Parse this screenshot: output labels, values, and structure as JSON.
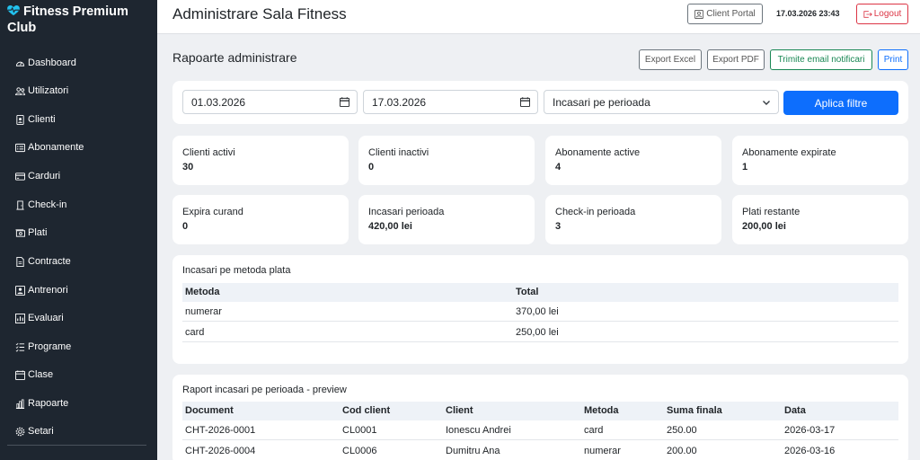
{
  "app": {
    "brand": "Fitness Premium Club",
    "brand_color": "#1e2630",
    "accent": "#0d6efd"
  },
  "sidebar": {
    "items": [
      {
        "label": "Dashboard",
        "icon": "speedometer-icon"
      },
      {
        "label": "Utilizatori",
        "icon": "people-icon"
      },
      {
        "label": "Clienti",
        "icon": "person-badge-icon"
      },
      {
        "label": "Abonamente",
        "icon": "card-list-icon"
      },
      {
        "label": "Carduri",
        "icon": "credit-card-icon"
      },
      {
        "label": "Check-in",
        "icon": "door-icon"
      },
      {
        "label": "Plati",
        "icon": "cash-icon"
      },
      {
        "label": "Contracte",
        "icon": "file-text-icon"
      },
      {
        "label": "Antrenori",
        "icon": "person-square-icon"
      },
      {
        "label": "Evaluari",
        "icon": "graph-icon"
      },
      {
        "label": "Programe",
        "icon": "list-check-icon"
      },
      {
        "label": "Clase",
        "icon": "calendar-icon"
      },
      {
        "label": "Rapoarte",
        "icon": "bar-chart-icon"
      },
      {
        "label": "Setari",
        "icon": "gear-icon"
      }
    ]
  },
  "header": {
    "title": "Administrare Sala Fitness",
    "client_portal": "Client Portal",
    "datetime": "17.03.2026 23:43",
    "logout": "Logout"
  },
  "reports": {
    "title": "Rapoarte administrare",
    "export_excel": "Export Excel",
    "export_pdf": "Export PDF",
    "send_email": "Trimite email notificari",
    "print": "Print"
  },
  "filters": {
    "date_from": "01.03.2026",
    "date_to": "17.03.2026",
    "report_type": "Incasari pe perioada",
    "apply": "Aplica filtre"
  },
  "stats": [
    {
      "label": "Clienti activi",
      "value": "30"
    },
    {
      "label": "Clienti inactivi",
      "value": "0"
    },
    {
      "label": "Abonamente active",
      "value": "4"
    },
    {
      "label": "Abonamente expirate",
      "value": "1"
    },
    {
      "label": "Expira curand",
      "value": "0"
    },
    {
      "label": "Incasari perioada",
      "value": "420,00 lei"
    },
    {
      "label": "Check-in perioada",
      "value": "3"
    },
    {
      "label": "Plati restante",
      "value": "200,00 lei"
    }
  ],
  "payments_by_method": {
    "title": "Incasari pe metoda plata",
    "columns": [
      "Metoda",
      "Total"
    ],
    "rows": [
      [
        "numerar",
        "370,00 lei"
      ],
      [
        "card",
        "250,00 lei"
      ]
    ]
  },
  "income_report": {
    "title": "Raport incasari pe perioada - preview",
    "columns": [
      "Document",
      "Cod client",
      "Client",
      "Metoda",
      "Suma finala",
      "Data"
    ],
    "rows": [
      [
        "CHT-2026-0001",
        "CL0001",
        "Ionescu Andrei",
        "card",
        "250.00",
        "2026-03-17"
      ],
      [
        "CHT-2026-0004",
        "CL0006",
        "Dumitru Ana",
        "numerar",
        "200.00",
        "2026-03-16"
      ]
    ]
  }
}
